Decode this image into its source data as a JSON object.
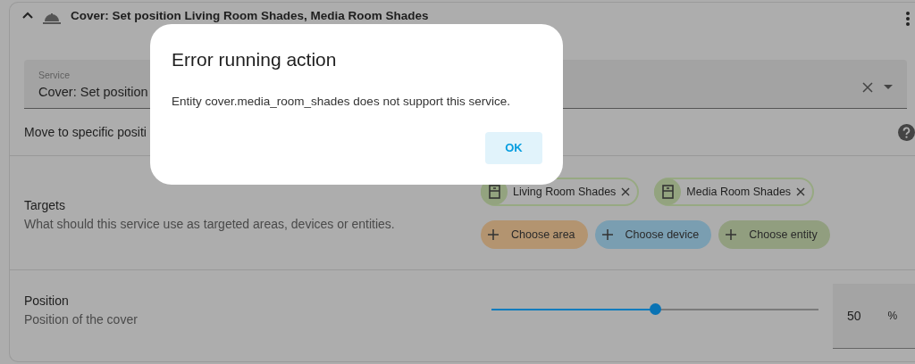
{
  "header": {
    "expanded": true,
    "title": "Cover: Set position Living Room Shades, Media Room Shades"
  },
  "service_field": {
    "label": "Service",
    "value": "Cover: Set position"
  },
  "service_description": "Move to specific positi",
  "targets": {
    "label": "Targets",
    "description": "What should this service use as targeted areas, devices or entities.",
    "selected": [
      {
        "label": "Living Room Shades"
      },
      {
        "label": "Media Room Shades"
      }
    ],
    "actions": [
      {
        "label": "Choose area",
        "color": "#b39470"
      },
      {
        "label": "Choose device",
        "color": "#7a9eb1"
      },
      {
        "label": "Choose entity",
        "color": "#919e7f"
      }
    ]
  },
  "position": {
    "label": "Position",
    "description": "Position of the cover",
    "level": 0.5,
    "value": "50",
    "unit": "%"
  },
  "dialog": {
    "title": "Error running action",
    "message": "Entity cover.media_room_shades does not support this service.",
    "button": "OK"
  }
}
